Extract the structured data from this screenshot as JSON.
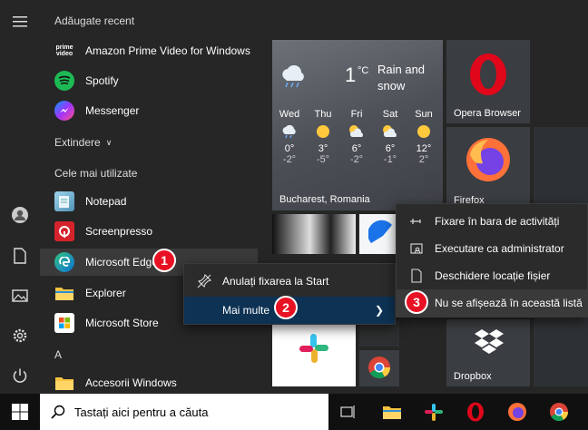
{
  "start_menu": {
    "sections": {
      "recent": "Adăugate recent",
      "expand": "Extindere",
      "most_used": "Cele mai utilizate",
      "letter_a": "A"
    },
    "recent_apps": [
      {
        "label": "Amazon Prime Video for Windows",
        "icon": "prime-video-icon",
        "icon_text": "prime video"
      },
      {
        "label": "Spotify",
        "icon": "spotify-icon"
      },
      {
        "label": "Messenger",
        "icon": "messenger-icon"
      }
    ],
    "most_used_apps": [
      {
        "label": "Notepad",
        "icon": "notepad-icon"
      },
      {
        "label": "Screenpresso",
        "icon": "screenpresso-icon"
      },
      {
        "label": "Microsoft Edge",
        "icon": "edge-icon"
      },
      {
        "label": "Explorer",
        "icon": "folder-icon"
      },
      {
        "label": "Microsoft Store",
        "icon": "store-icon"
      }
    ],
    "a_apps": [
      {
        "label": "Accesorii Windows",
        "icon": "folder-icon"
      }
    ]
  },
  "weather": {
    "temp": "1",
    "unit": "°C",
    "condition": "Rain and snow",
    "location": "Bucharest, Romania",
    "days": [
      {
        "day": "Wed",
        "hi": "0°",
        "lo": "-2°",
        "icon": "rain-snow-icon"
      },
      {
        "day": "Thu",
        "hi": "3°",
        "lo": "-5°",
        "icon": "sun-icon"
      },
      {
        "day": "Fri",
        "hi": "6°",
        "lo": "-2°",
        "icon": "partly-cloudy-icon"
      },
      {
        "day": "Sat",
        "hi": "6°",
        "lo": "-1°",
        "icon": "partly-cloudy-icon"
      },
      {
        "day": "Sun",
        "hi": "12°",
        "lo": "2°",
        "icon": "sun-icon"
      }
    ]
  },
  "tiles": {
    "opera": "Opera Browser",
    "firefox": "Firefox",
    "dropbox": "Dropbox"
  },
  "menu1": {
    "unpin": "Anulați fixarea la Start",
    "more": "Mai multe"
  },
  "menu2": {
    "pin_taskbar": "Fixare în bara de activități",
    "run_admin": "Executare ca administrator",
    "open_location": "Deschidere locație fișier",
    "hide_in_list": "Nu se afișează în această listă"
  },
  "badges": [
    "1",
    "2",
    "3"
  ],
  "taskbar": {
    "search_placeholder": "Tastați aici pentru a căuta"
  },
  "colors": {
    "badge": "#e81123",
    "menu_highlight": "#0d3253",
    "opera_red": "#e0071b"
  }
}
